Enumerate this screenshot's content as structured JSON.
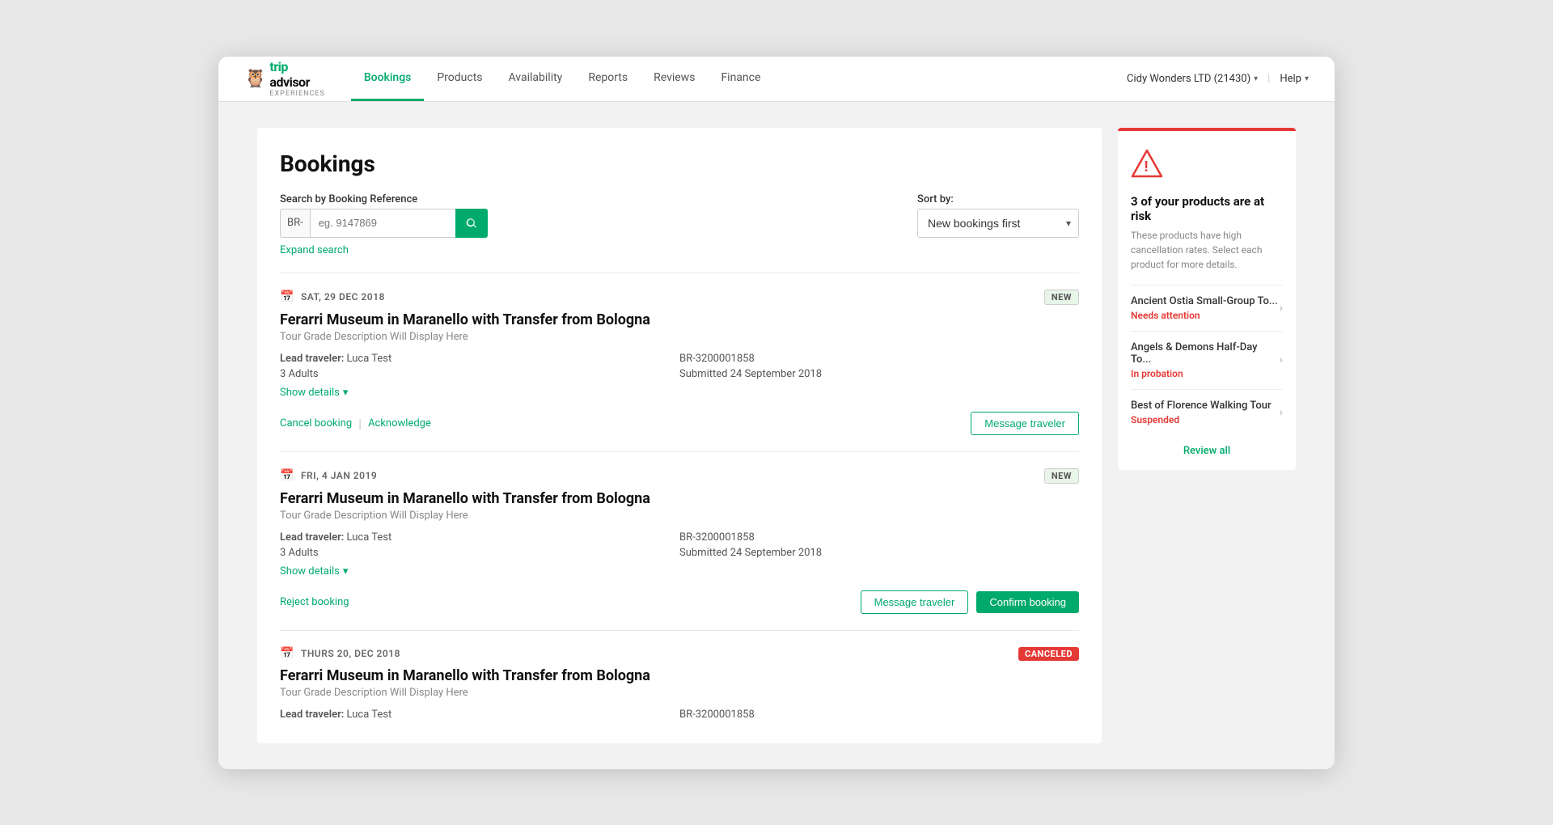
{
  "nav": {
    "logo_trip": "trip",
    "logo_advisor": "advisor",
    "logo_exp": "Experiences",
    "links": [
      {
        "label": "Bookings",
        "active": true
      },
      {
        "label": "Products",
        "active": false
      },
      {
        "label": "Availability",
        "active": false
      },
      {
        "label": "Reports",
        "active": false
      },
      {
        "label": "Reviews",
        "active": false
      },
      {
        "label": "Finance",
        "active": false
      }
    ],
    "account": "Cidy Wonders LTD (21430)",
    "help": "Help"
  },
  "page": {
    "title": "Bookings",
    "search_label": "Search by Booking Reference",
    "search_prefix": "BR-",
    "search_placeholder": "eg. 9147869",
    "sort_label": "Sort by:",
    "sort_value": "New bookings first",
    "expand_search": "Expand search"
  },
  "bookings": [
    {
      "date": "SAT, 29 DEC 2018",
      "badge": "NEW",
      "badge_type": "new",
      "title": "Ferarri Museum in Maranello with Transfer from Bologna",
      "grade": "Tour Grade Description Will Display Here",
      "lead_traveler_label": "Lead traveler:",
      "lead_traveler": "Luca Test",
      "adults": "3 Adults",
      "reference": "BR-3200001858",
      "submitted": "Submitted 24 September 2018",
      "show_details": "Show details",
      "actions_left": [
        {
          "label": "Cancel booking"
        },
        {
          "label": "Acknowledge"
        }
      ],
      "actions_right": [
        {
          "label": "Message traveler",
          "type": "outline"
        }
      ]
    },
    {
      "date": "FRI, 4 JAN 2019",
      "badge": "NEW",
      "badge_type": "new",
      "title": "Ferarri Museum in Maranello with Transfer from Bologna",
      "grade": "Tour Grade Description Will Display Here",
      "lead_traveler_label": "Lead traveler:",
      "lead_traveler": "Luca Test",
      "adults": "3 Adults",
      "reference": "BR-3200001858",
      "submitted": "Submitted 24 September 2018",
      "show_details": "Show details",
      "actions_left": [
        {
          "label": "Reject booking"
        }
      ],
      "actions_right": [
        {
          "label": "Message traveler",
          "type": "outline"
        },
        {
          "label": "Confirm booking",
          "type": "solid"
        }
      ]
    },
    {
      "date": "THURS 20, DEC 2018",
      "badge": "CANCELED",
      "badge_type": "canceled",
      "title": "Ferarri Museum in Maranello with Transfer from Bologna",
      "grade": "Tour Grade Description Will Display Here",
      "lead_traveler_label": "Lead traveler:",
      "lead_traveler": "Luca Test",
      "adults": null,
      "reference": "BR-3200001858",
      "submitted": null,
      "show_details": null,
      "actions_left": [],
      "actions_right": []
    }
  ],
  "risk": {
    "title": "3 of your products are at risk",
    "desc": "These products have high cancellation rates. Select each product for more details.",
    "products": [
      {
        "name": "Ancient Ostia Small-Group To...",
        "status": "Needs attention",
        "status_type": "attention"
      },
      {
        "name": "Angels & Demons Half-Day To...",
        "status": "In probation",
        "status_type": "probation"
      },
      {
        "name": "Best of Florence Walking Tour",
        "status": "Suspended",
        "status_type": "suspended"
      }
    ],
    "review_all": "Review all"
  }
}
